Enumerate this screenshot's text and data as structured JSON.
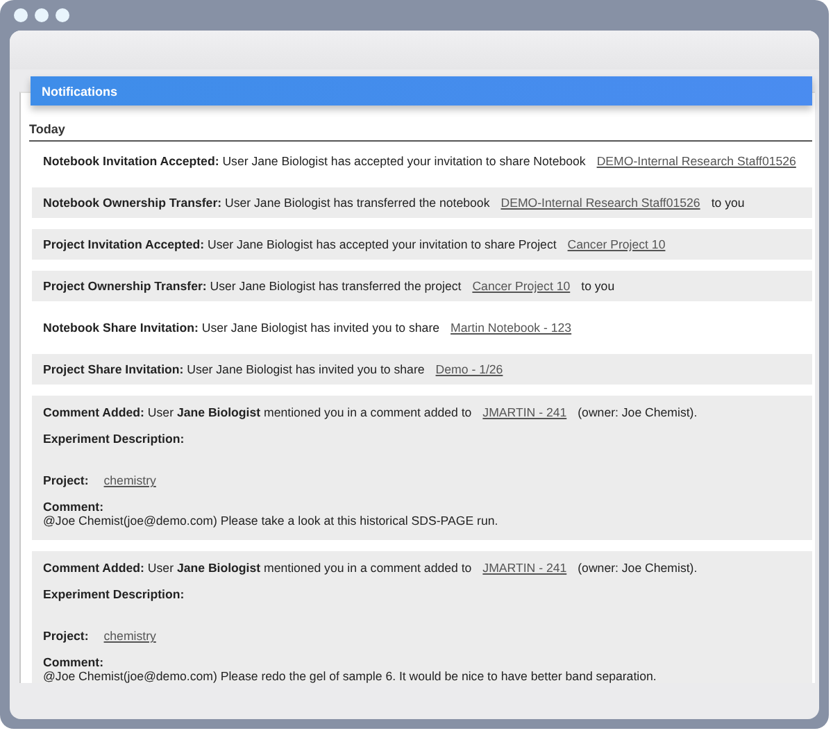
{
  "panel": {
    "title": "Notifications",
    "section": "Today"
  },
  "notifications": [
    {
      "kind": "event",
      "shaded": false,
      "text": "**Notebook Invitation Accepted:** User Jane Biologist has accepted your invitation to share Notebook",
      "link": "DEMO-Internal Research Staff01526"
    },
    {
      "kind": "event",
      "shaded": true,
      "text": "**Notebook Ownership Transfer:** User Jane Biologist has transferred the notebook",
      "link": "DEMO-Internal Research Staff01526",
      "after": "to you"
    },
    {
      "kind": "event",
      "shaded": true,
      "text": "**Project Invitation Accepted:** User Jane Biologist has accepted your invitation to share Project",
      "link": "Cancer Project 10"
    },
    {
      "kind": "event",
      "shaded": true,
      "text": "**Project Ownership Transfer:** User Jane Biologist has transferred the project",
      "link": "Cancer Project 10",
      "after": "to you"
    },
    {
      "kind": "event",
      "shaded": false,
      "text": "**Notebook Share Invitation:** User Jane Biologist has invited you to share",
      "link": "Martin Notebook - 123"
    },
    {
      "kind": "event",
      "shaded": true,
      "text": "**Project Share Invitation:** User Jane Biologist has invited you to share",
      "link": "Demo - 1/26"
    },
    {
      "kind": "comment",
      "shaded": true,
      "text": "**Comment Added:** User **Jane Biologist** mentioned you in a comment added to",
      "link": "JMARTIN - 241",
      "after": "(owner: Joe Chemist).",
      "description_label": "Experiment Description:",
      "project_label": "Project:",
      "project_link": "chemistry",
      "comment_label": "Comment:",
      "comment": "@Joe Chemist(joe@demo.com) Please take a look at this historical SDS-PAGE run."
    },
    {
      "kind": "comment",
      "shaded": true,
      "text": "**Comment Added:** User **Jane Biologist** mentioned you in a comment added to",
      "link": "JMARTIN - 241",
      "after": "(owner: Joe Chemist).",
      "description_label": "Experiment Description:",
      "project_label": "Project:",
      "project_link": "chemistry",
      "comment_label": "Comment:",
      "comment": "@Joe Chemist(joe@demo.com) Please redo the gel of sample 6. It would be nice to have better band separation."
    }
  ]
}
